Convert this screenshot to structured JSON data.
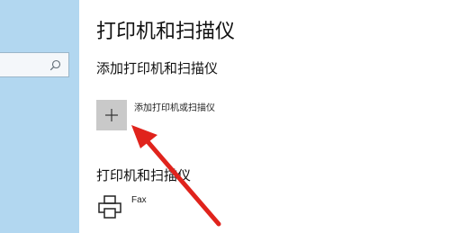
{
  "header": {
    "title": "打印机和扫描仪"
  },
  "add_section": {
    "title": "添加打印机和扫描仪",
    "button_label": "添加打印机或扫描仪"
  },
  "list_section": {
    "title": "打印机和扫描仪",
    "devices": [
      {
        "name": "Fax",
        "icon": "printer-icon"
      }
    ]
  },
  "search": {
    "icon": "search-icon"
  },
  "colors": {
    "sidebar_bg": "#b2d7f0",
    "tile_bg": "#c9c9c9",
    "annotation_arrow": "#e0231c"
  }
}
